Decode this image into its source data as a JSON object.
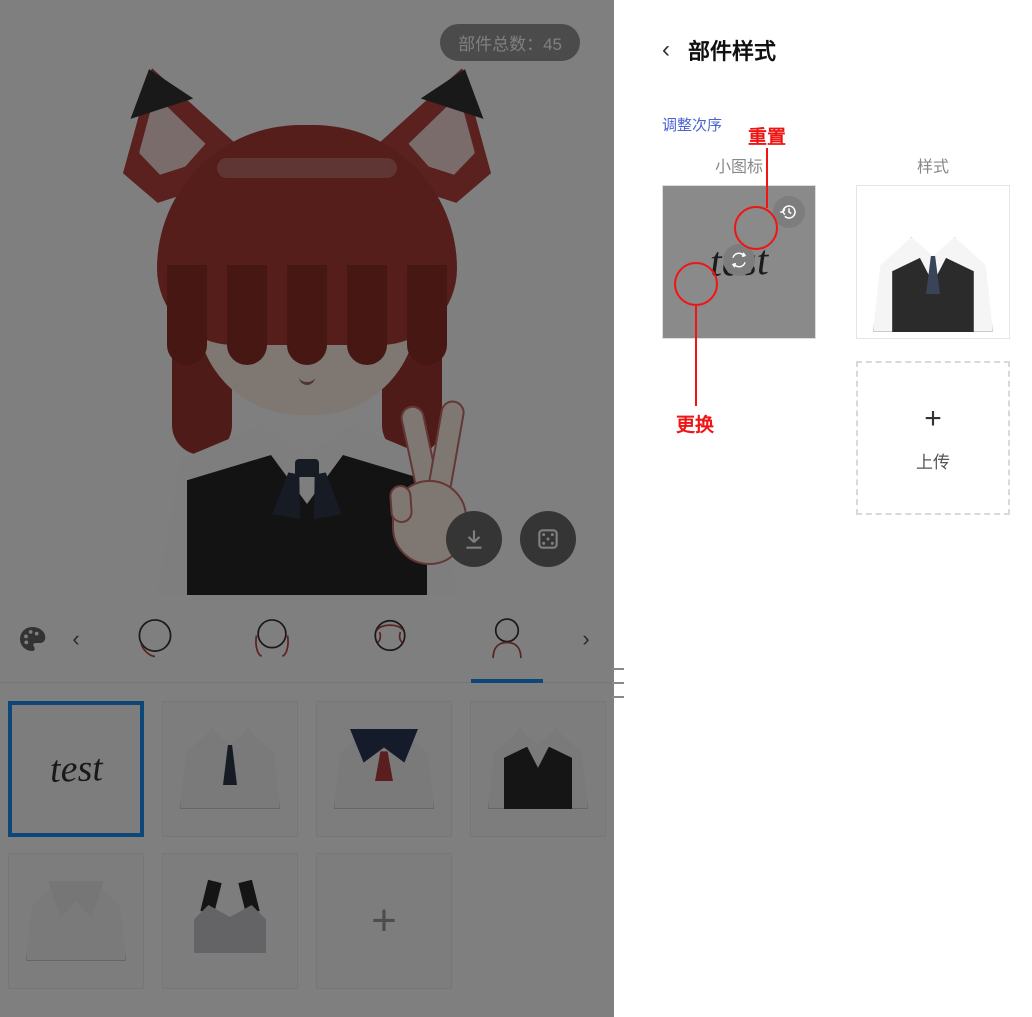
{
  "preview": {
    "badge_prefix": "部件总数：",
    "badge_count": 45
  },
  "categories": [
    {
      "id": "face",
      "selected": false
    },
    {
      "id": "hair-back",
      "selected": false
    },
    {
      "id": "hair-front",
      "selected": false
    },
    {
      "id": "outfit",
      "selected": true
    }
  ],
  "samples": [
    {
      "id": "test",
      "label": "test",
      "kind": "text",
      "selected": true
    },
    {
      "id": "s1",
      "kind": "shirt-tie",
      "selected": false
    },
    {
      "id": "s2",
      "kind": "sailor",
      "selected": false
    },
    {
      "id": "s3",
      "kind": "vest",
      "selected": false
    },
    {
      "id": "s4",
      "kind": "collar",
      "selected": false
    },
    {
      "id": "s5",
      "kind": "maid",
      "selected": false
    },
    {
      "id": "add",
      "kind": "add",
      "selected": false
    }
  ],
  "panel": {
    "title": "部件样式",
    "reorder": "调整次序",
    "col_icon": "小图标",
    "col_style": "样式",
    "thumb_text": "test",
    "upload": "上传",
    "add_glyph": "+"
  },
  "annotations": {
    "reset": "重置",
    "swap": "更换"
  }
}
